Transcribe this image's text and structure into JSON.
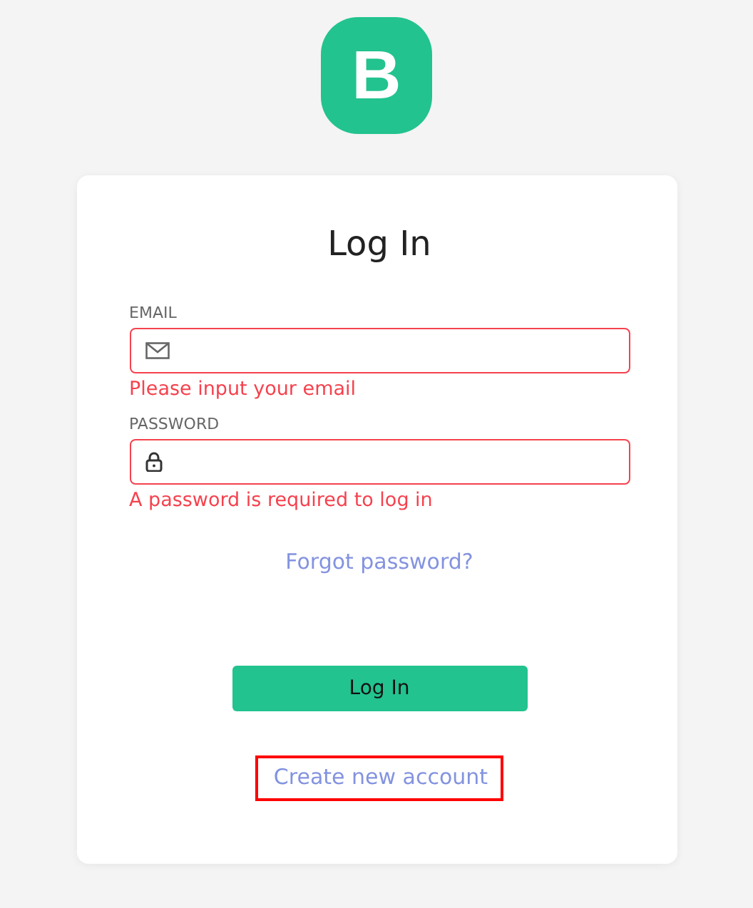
{
  "logo": {
    "letter": "B"
  },
  "title": "Log In",
  "fields": [
    {
      "kind": "email",
      "label": "EMAIL",
      "error": "Please input your email"
    },
    {
      "kind": "password",
      "label": "PASSWORD",
      "error": "A password is required to log in"
    }
  ],
  "forgot_link": "Forgot password?",
  "submit_button": "Log In",
  "create_link": {
    "label": "Create new account",
    "highlighted": true
  }
}
